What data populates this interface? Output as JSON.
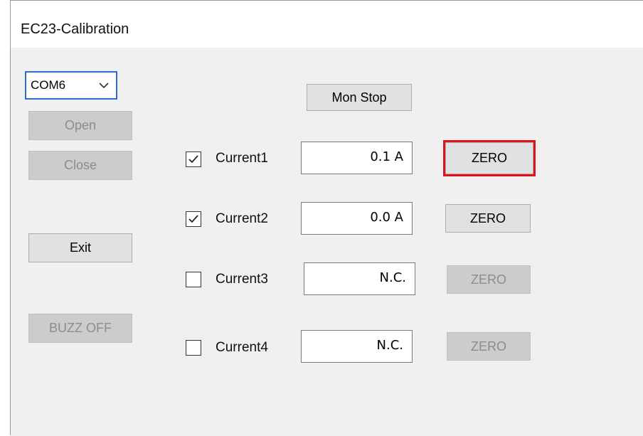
{
  "window": {
    "title": "EC23-Calibration"
  },
  "port": {
    "selected": "COM6"
  },
  "left_buttons": {
    "open": "Open",
    "close": "Close",
    "exit": "Exit",
    "buzz_off": "BUZZ OFF"
  },
  "monitor": {
    "button_label": "Mon Stop"
  },
  "channels": [
    {
      "label": "Current1",
      "checked": true,
      "value": "0.1 A",
      "zero": "ZERO"
    },
    {
      "label": "Current2",
      "checked": true,
      "value": "0.0 A",
      "zero": "ZERO"
    },
    {
      "label": "Current3",
      "checked": false,
      "value": "N.C.",
      "zero": "ZERO"
    },
    {
      "label": "Current4",
      "checked": false,
      "value": "N.C.",
      "zero": "ZERO"
    }
  ],
  "colors": {
    "highlight": "#e0101c",
    "focus_border": "#2d6fd1"
  }
}
